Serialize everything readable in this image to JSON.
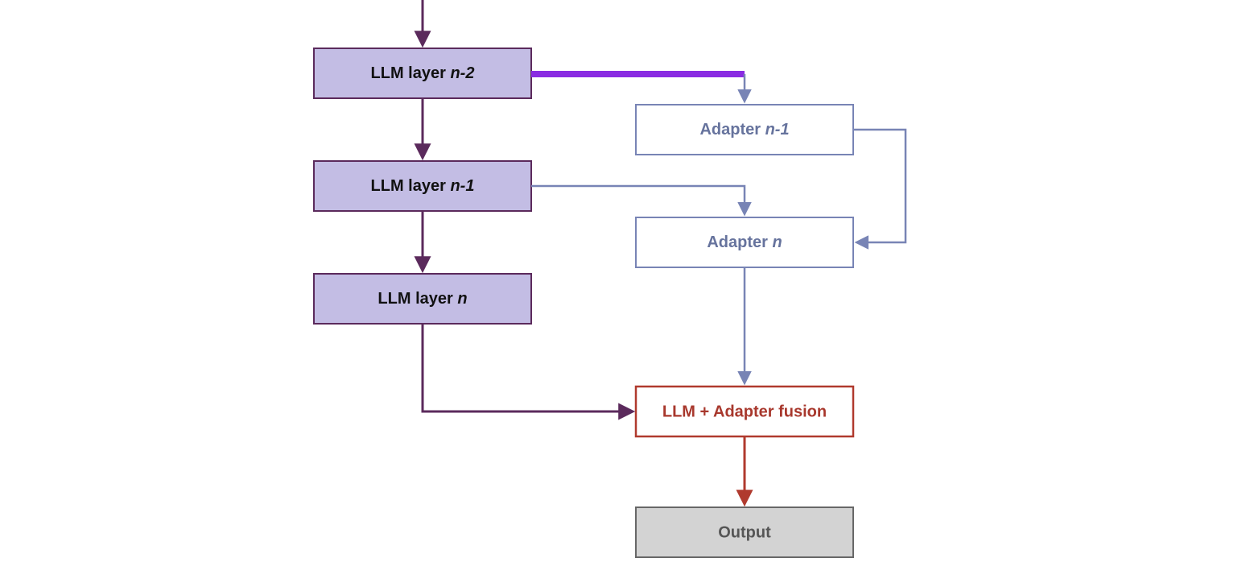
{
  "nodes": {
    "llm_n2": {
      "pre": "LLM layer ",
      "var": "n-2"
    },
    "llm_n1": {
      "pre": "LLM layer ",
      "var": "n-1"
    },
    "llm_n": {
      "pre": "LLM layer ",
      "var": "n"
    },
    "adapter_n1": {
      "pre": "Adapter ",
      "var": "n-1"
    },
    "adapter_n": {
      "pre": "Adapter ",
      "var": "n"
    },
    "fusion": "LLM + Adapter fusion",
    "output": "Output"
  },
  "colors": {
    "llm_fill": "#c3bde4",
    "llm_stroke": "#5b2a5c",
    "adapter_stroke": "#7884b5",
    "adapter_text": "#66739d",
    "fusion_stroke": "#b03a2e",
    "fusion_text": "#a8382d",
    "output_fill": "#d3d3d3",
    "output_stroke": "#676767",
    "output_text": "#565656",
    "highlight": "#8a2be2"
  }
}
